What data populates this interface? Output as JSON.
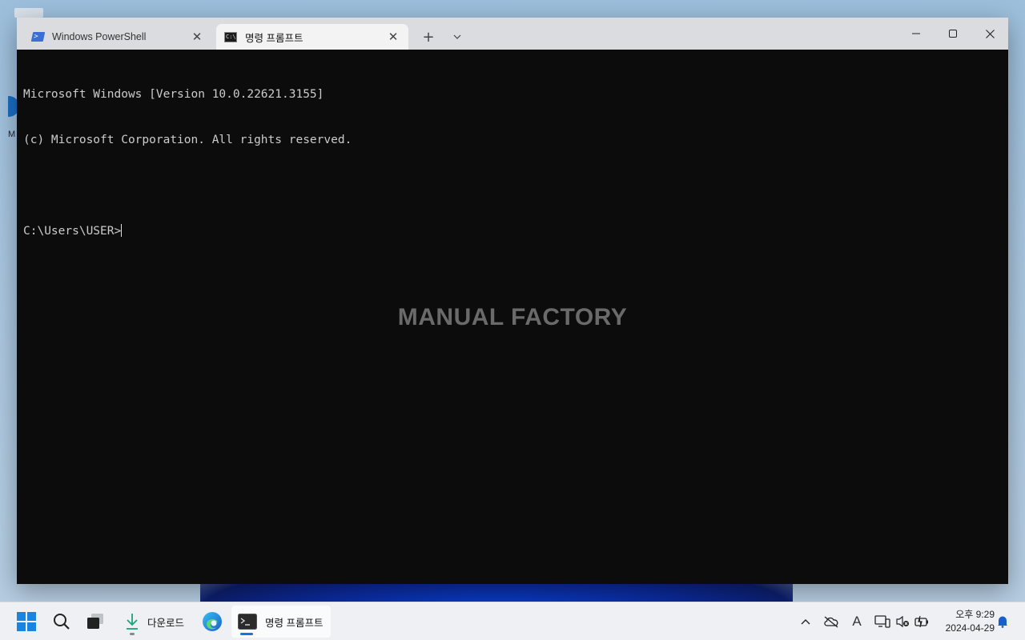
{
  "window": {
    "tabs": [
      {
        "label": "Windows PowerShell",
        "icon": "powershell-icon",
        "active": false
      },
      {
        "label": "명령 프롬프트",
        "icon": "command-prompt-icon",
        "active": true
      }
    ],
    "new_tab_label": "+",
    "close_glyph": "✕"
  },
  "terminal": {
    "lines": [
      "Microsoft Windows [Version 10.0.22621.3155]",
      "(c) Microsoft Corporation. All rights reserved.",
      "",
      "C:\\Users\\USER>"
    ],
    "watermark": "MANUAL FACTORY"
  },
  "taskbar": {
    "downloads_label": "다운로드",
    "cmd_label": "명령 프롬프트",
    "clock_time": "오후 9:29",
    "clock_date": "2024-04-29",
    "ime_indicator": "A"
  },
  "desktop": {
    "icon_label_fragment": "M"
  },
  "colors": {
    "terminal_bg": "#0c0c0c",
    "terminal_fg": "#cccccc",
    "accent": "#1a73d9"
  }
}
